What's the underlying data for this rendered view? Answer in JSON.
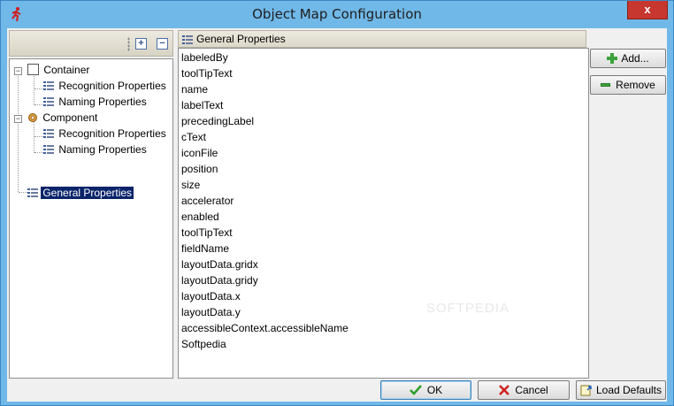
{
  "window": {
    "title": "Object Map Configuration",
    "close_glyph": "x"
  },
  "tree": {
    "items": [
      {
        "label": "Container",
        "icon": "box-icon"
      },
      {
        "label": "Recognition Properties",
        "icon": "list-icon"
      },
      {
        "label": "Naming Properties",
        "icon": "list-icon"
      },
      {
        "label": "Component",
        "icon": "gear-icon"
      },
      {
        "label": "Recognition Properties",
        "icon": "list-icon"
      },
      {
        "label": "Naming Properties",
        "icon": "list-icon"
      },
      {
        "label": "General Properties",
        "icon": "list-icon",
        "selected": true
      }
    ],
    "expand_all": "+",
    "collapse_all": "−",
    "expander_collapse_glyph": "−"
  },
  "panel": {
    "header": "General Properties",
    "properties": [
      "labeledBy",
      "toolTipText",
      "name",
      "labelText",
      "precedingLabel",
      "cText",
      "iconFile",
      "position",
      "size",
      "accelerator",
      "enabled",
      "toolTipText",
      "fieldName",
      "layoutData.gridx",
      "layoutData.gridy",
      "layoutData.x",
      "layoutData.y",
      "accessibleContext.accessibleName",
      "Softpedia"
    ],
    "watermark": "SOFTPEDIA"
  },
  "buttons": {
    "add": "Add...",
    "remove": "Remove",
    "ok": "OK",
    "cancel": "Cancel",
    "load_defaults": "Load Defaults"
  },
  "colors": {
    "titlebar": "#70b8e8",
    "selection": "#0a246a",
    "close": "#c7372f"
  }
}
